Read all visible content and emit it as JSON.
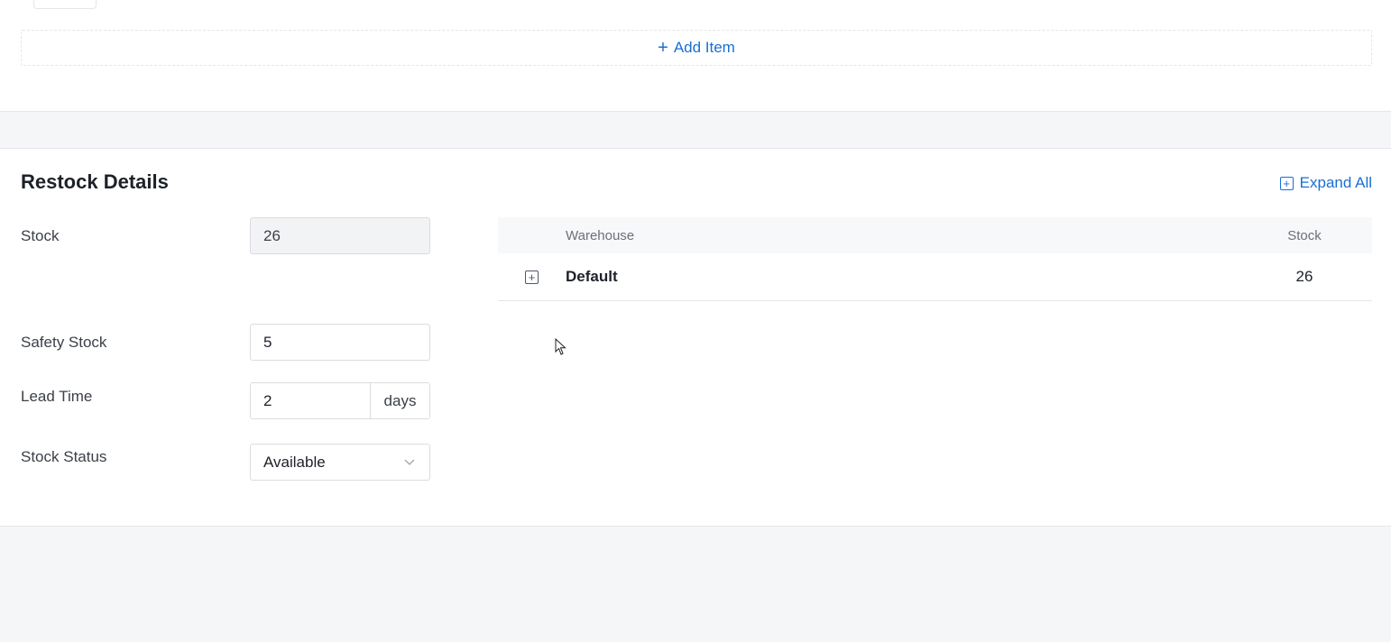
{
  "top_section": {
    "add_item_label": "Add Item"
  },
  "restock": {
    "title": "Restock Details",
    "expand_all_label": "Expand All",
    "fields": {
      "stock": {
        "label": "Stock",
        "value": "26"
      },
      "safety_stock": {
        "label": "Safety Stock",
        "value": "5"
      },
      "lead_time": {
        "label": "Lead Time",
        "value": "2",
        "unit": "days"
      },
      "stock_status": {
        "label": "Stock Status",
        "value": "Available"
      }
    },
    "table": {
      "columns": [
        "Warehouse",
        "Stock"
      ],
      "rows": [
        {
          "warehouse": "Default",
          "stock": "26"
        }
      ]
    }
  },
  "colors": {
    "accent": "#1a6fd4",
    "page_bg": "#f5f6f7",
    "border": "#e5e6eb"
  },
  "icons": {
    "add": "plus-icon",
    "expand_all": "plus-square-icon",
    "row_expand": "plus-square-icon",
    "select_caret": "chevron-down-icon"
  }
}
